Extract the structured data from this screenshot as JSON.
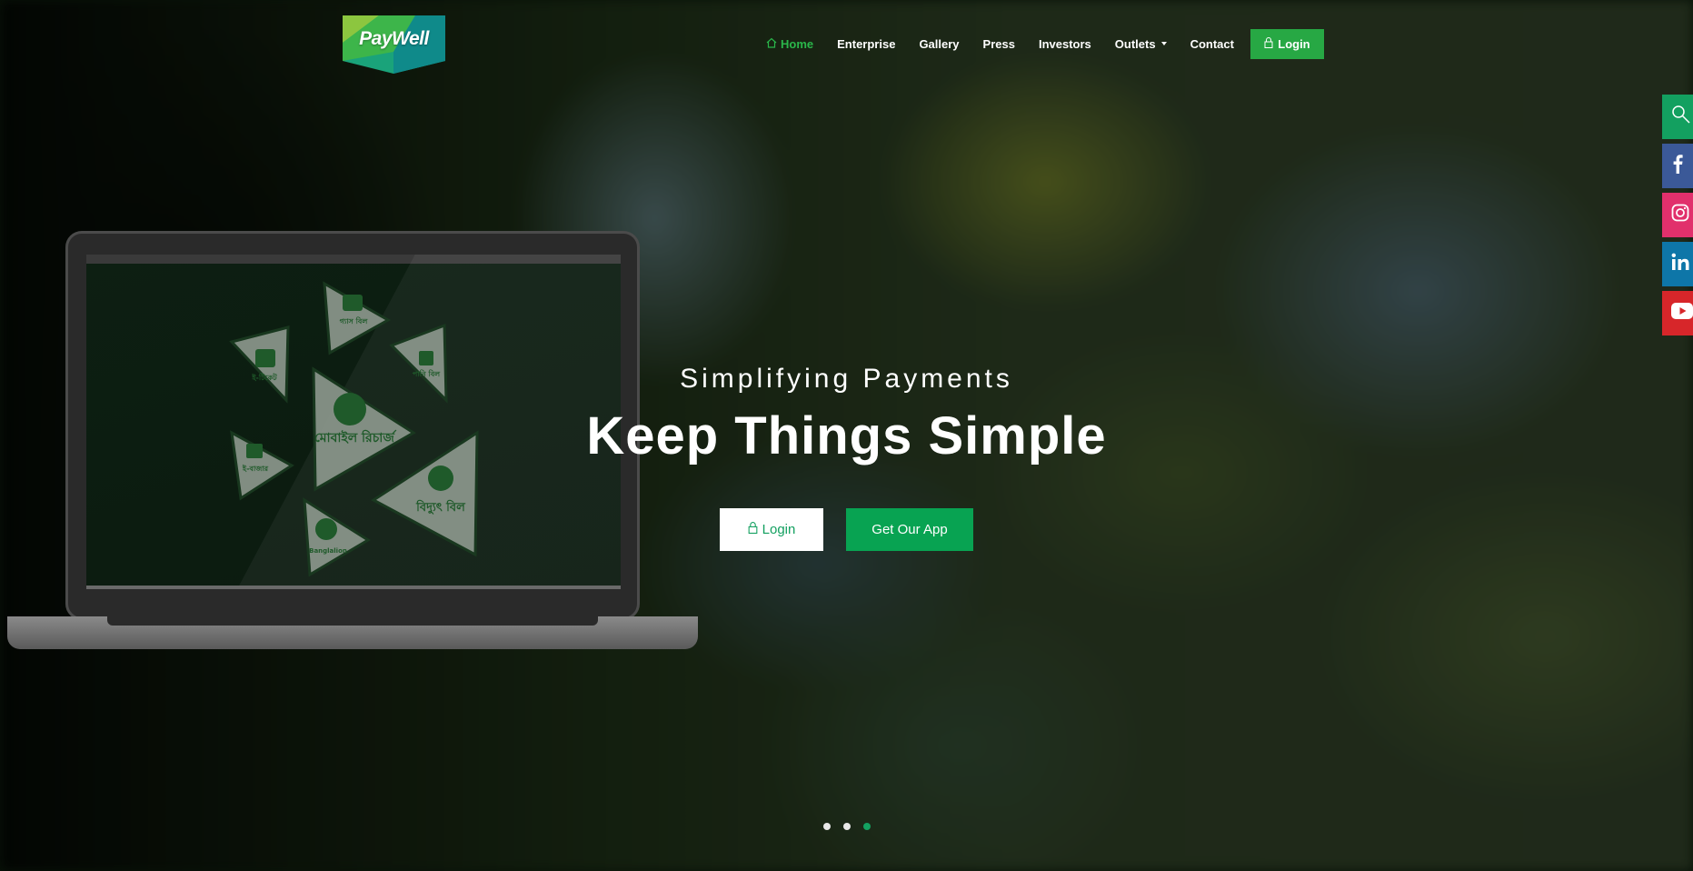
{
  "brand": {
    "logo_text": "PayWell"
  },
  "nav": {
    "items": [
      {
        "label": "Home",
        "active": true,
        "icon": "home-icon"
      },
      {
        "label": "Enterprise"
      },
      {
        "label": "Gallery"
      },
      {
        "label": "Press"
      },
      {
        "label": "Investors"
      },
      {
        "label": "Outlets",
        "dropdown": true
      },
      {
        "label": "Contact"
      }
    ],
    "login_label": "Login"
  },
  "social": [
    {
      "name": "search",
      "icon": "search-icon",
      "color": "#13a060"
    },
    {
      "name": "facebook",
      "icon": "facebook-icon",
      "color": "#3b5998"
    },
    {
      "name": "instagram",
      "icon": "instagram-icon",
      "color": "#e1306c"
    },
    {
      "name": "linkedin",
      "icon": "linkedin-icon",
      "color": "#0e76a8"
    },
    {
      "name": "youtube",
      "icon": "youtube-icon",
      "color": "#d7262a"
    }
  ],
  "hero": {
    "subtitle": "Simplifying Payments",
    "title": "Keep Things Simple",
    "login_button": "Login",
    "app_button": "Get Our App"
  },
  "laptop_screen": {
    "tiles": [
      {
        "label": "মোবাইল রিচার্জ",
        "icon": "mobile-icon"
      },
      {
        "label": "বিদ্যুৎ বিল",
        "icon": "bulb-icon"
      },
      {
        "label": "ই-টিকেট",
        "icon": "train-icon"
      },
      {
        "label": "গ্যাস বিল",
        "icon": "gas-icon"
      },
      {
        "label": "পানি বিল",
        "icon": "water-tap-icon"
      },
      {
        "label": "ই-বাজার",
        "icon": "cart-icon"
      },
      {
        "label": "Banglalion",
        "icon": "lion-icon"
      }
    ]
  },
  "carousel": {
    "slides": 3,
    "active_index": 2
  },
  "colors": {
    "accent": "#27a844",
    "green_dark": "#13a060"
  }
}
